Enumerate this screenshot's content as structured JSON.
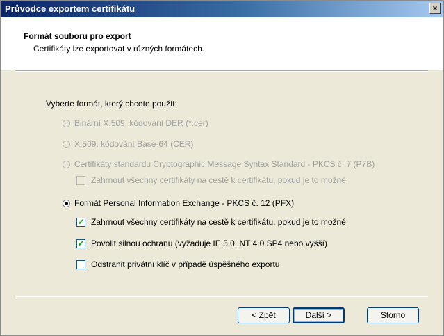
{
  "window": {
    "title": "Průvodce exportem certifikátu",
    "close_label": "×"
  },
  "header": {
    "title": "Formát souboru pro export",
    "subtitle": "Certifikáty lze exportovat v různých formátech."
  },
  "prompt": "Vyberte formát, který chcete použít:",
  "options": {
    "der": {
      "label": "Binární X.509, kódování DER (*.cer)",
      "selected": false,
      "enabled": false
    },
    "base64": {
      "label": "X.509, kódování Base-64 (CER)",
      "selected": false,
      "enabled": false
    },
    "p7b": {
      "label": "Certifikáty standardu Cryptographic Message Syntax Standard - PKCS č. 7 (P7B)",
      "selected": false,
      "enabled": false
    },
    "p7b_include": {
      "label": "Zahrnout všechny certifikáty na cestě k certifikátu, pokud je to možné",
      "checked": false,
      "enabled": false
    },
    "pfx": {
      "label": "Formát Personal Information Exchange - PKCS č. 12 (PFX)",
      "selected": true,
      "enabled": true
    },
    "pfx_include": {
      "label": "Zahrnout všechny certifikáty na cestě k certifikátu, pokud je to možné",
      "checked": true,
      "enabled": true
    },
    "pfx_strong": {
      "label": "Povolit silnou ochranu (vyžaduje IE 5.0, NT 4.0 SP4 nebo vyšší)",
      "checked": true,
      "enabled": true
    },
    "pfx_delete_key": {
      "label": "Odstranit privátní klíč v případě úspěšného exportu",
      "checked": false,
      "enabled": true
    }
  },
  "buttons": {
    "back": "< Zpět",
    "next": "Další >",
    "cancel": "Storno"
  },
  "colors": {
    "title_start": "#0a246a",
    "title_end": "#a6caf0",
    "check_mark": "#21a121",
    "disabled_text": "#a0a0a0"
  }
}
